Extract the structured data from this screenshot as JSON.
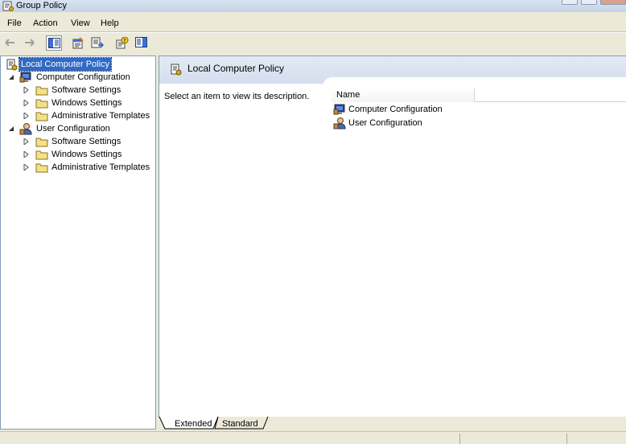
{
  "window": {
    "title": "Group Policy"
  },
  "menu": {
    "items": [
      "File",
      "Action",
      "View",
      "Help"
    ]
  },
  "toolbar": {
    "buttons": [
      {
        "icon": "back-arrow-icon"
      },
      {
        "icon": "forward-arrow-icon"
      },
      {
        "icon": "show-hide-tree-icon"
      },
      {
        "icon": "properties-icon"
      },
      {
        "icon": "export-list-icon"
      },
      {
        "icon": "help-icon"
      },
      {
        "icon": "show-hide-action-pane-icon"
      }
    ]
  },
  "tree": {
    "root": "Local Computer Policy",
    "computer_configuration": {
      "label": "Computer Configuration",
      "children": [
        "Software Settings",
        "Windows Settings",
        "Administrative Templates"
      ]
    },
    "user_configuration": {
      "label": "User Configuration",
      "children": [
        "Software Settings",
        "Windows Settings",
        "Administrative Templates"
      ]
    }
  },
  "details": {
    "title": "Local Computer Policy",
    "description": "Select an item to view its description.",
    "column_name": "Name",
    "items": [
      "Computer Configuration",
      "User Configuration"
    ]
  },
  "tabs": {
    "extended": "Extended",
    "standard": "Standard"
  },
  "colors": {
    "selection": "#316ac5",
    "background": "#ece9d8",
    "border": "#7f9db9"
  }
}
